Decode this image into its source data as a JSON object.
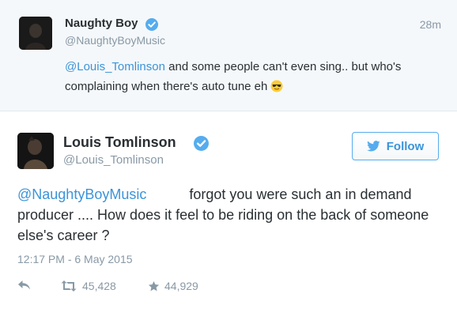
{
  "reply_tweet": {
    "author_name": "Naughty Boy",
    "author_handle": "@NaughtyBoyMusic",
    "time_ago": "28m",
    "mention": "@Louis_Tomlinson",
    "text": " and some people can't even sing.. but who's complaining when there's auto tune eh",
    "emoji_icon": "sunglasses-emoji-icon"
  },
  "main_tweet": {
    "author_name": "Louis Tomlinson",
    "author_handle": "@Louis_Tomlinson",
    "follow_label": "Follow",
    "mention": "@NaughtyBoyMusic",
    "text": "forgot you were such an in demand producer .... How does it feel to be riding on the back of someone else's career ?",
    "timestamp": "12:17 PM - 6 May 2015",
    "retweet_count": "45,428",
    "favorite_count": "44,929"
  },
  "colors": {
    "link": "#3b94d9",
    "verified": "#55acee",
    "muted": "#8899a6",
    "text": "#292f33",
    "top_bg": "#f5f8fa"
  }
}
